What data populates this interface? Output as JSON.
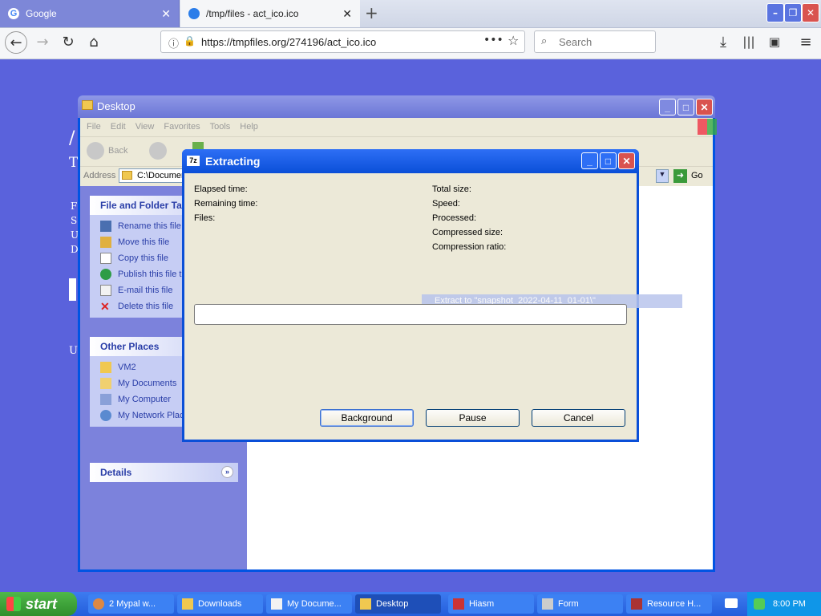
{
  "browser": {
    "tabs": [
      {
        "label": "Google",
        "active": false
      },
      {
        "label": "/tmp/files - act_ico.ico",
        "active": true
      }
    ],
    "url": "https://tmpfiles.org/274196/act_ico.ico",
    "search_placeholder": "Search"
  },
  "page_fragments": {
    "slash": "/",
    "t": "T",
    "f": "F",
    "s": "S",
    "u1": "U",
    "d": "D",
    "u2": "U"
  },
  "explorer": {
    "title": "Desktop",
    "menu": [
      "File",
      "Edit",
      "View",
      "Favorites",
      "Tools",
      "Help"
    ],
    "toolbar": {
      "back": "Back"
    },
    "address_label": "Address",
    "address_value": "C:\\Documen",
    "go_label": "Go",
    "file_tasks": {
      "title": "File and Folder Tas",
      "items": [
        "Rename this file",
        "Move this file",
        "Copy this file",
        "Publish this file to",
        "E-mail this file",
        "Delete this file"
      ]
    },
    "other_places": {
      "title": "Other Places",
      "items": [
        "VM2",
        "My Documents",
        "My Computer",
        "My Network Plac"
      ]
    },
    "details": {
      "title": "Details"
    }
  },
  "dialog": {
    "title": "Extracting",
    "left_labels": [
      "Elapsed time:",
      "Remaining time:",
      "Files:"
    ],
    "right_labels": [
      "Total size:",
      "Speed:",
      "Processed:",
      "Compressed size:",
      "Compression ratio:"
    ],
    "extract_to": "Extract to \"snapshot_2022-04-11_01-01\\\"",
    "progress": 0,
    "buttons": {
      "background": "Background",
      "pause": "Pause",
      "cancel": "Cancel"
    }
  },
  "taskbar": {
    "start": "start",
    "tasks": [
      {
        "label": "2 Mypal w...",
        "active": false
      },
      {
        "label": "Downloads",
        "active": false
      },
      {
        "label": "My Docume...",
        "active": false
      },
      {
        "label": "Desktop",
        "active": true
      },
      {
        "label": "Hiasm",
        "active": false
      },
      {
        "label": "Form",
        "active": false
      },
      {
        "label": "Resource H...",
        "active": false
      }
    ],
    "clock": "8:00 PM"
  }
}
